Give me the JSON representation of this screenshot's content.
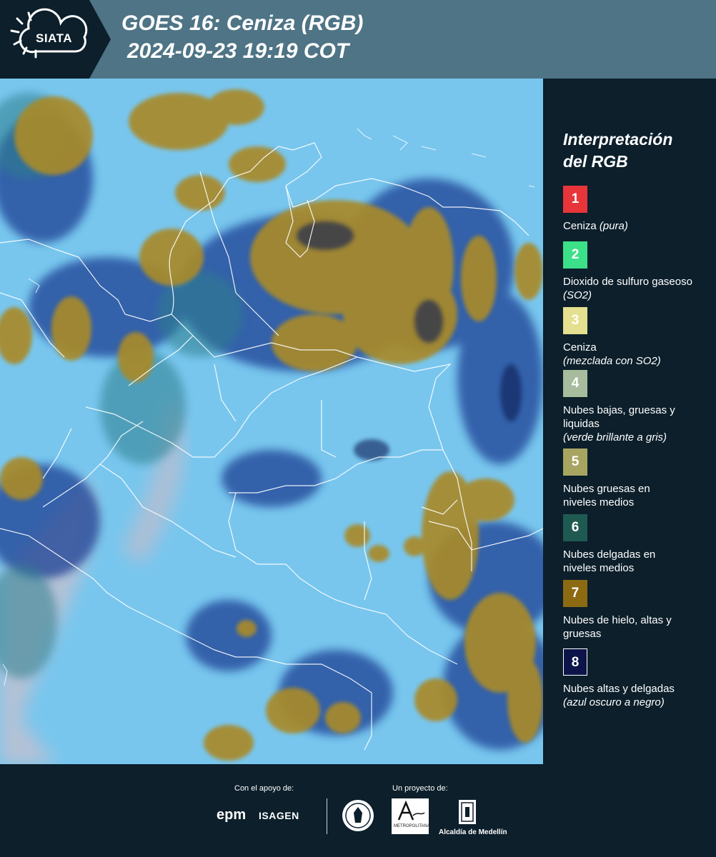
{
  "header": {
    "logo_text": "SIATA",
    "title_line1": "GOES 16: Ceniza (RGB)",
    "title_line2": "2024-09-23 19:19 COT"
  },
  "legend": {
    "title_line1": "Interpretación",
    "title_line2": "del RGB",
    "items": [
      {
        "number": "1",
        "color": "#e8353a",
        "label": "Ceniza",
        "note": "(pura)"
      },
      {
        "number": "2",
        "color": "#3ce089",
        "label": "Dioxido de sulfuro gaseoso",
        "note": "(SO2)"
      },
      {
        "number": "3",
        "color": "#e4e08f",
        "label": "Ceniza",
        "note": "(mezclada con SO2)"
      },
      {
        "number": "4",
        "color": "#a6bc9c",
        "label": "Nubes bajas, gruesas y liquidas",
        "note": "(verde brillante a gris)"
      },
      {
        "number": "5",
        "color": "#a8a560",
        "label": "Nubes gruesas en niveles medios",
        "note": ""
      },
      {
        "number": "6",
        "color": "#1f5a52",
        "label": "Nubes delgadas en niveles medios",
        "note": ""
      },
      {
        "number": "7",
        "color": "#8c6a12",
        "label": "Nubes de hielo, altas y gruesas",
        "note": ""
      },
      {
        "number": "8",
        "color": "#0c1449",
        "label": "Nubes altas y delgadas",
        "note": "(azul oscuro a negro)"
      }
    ]
  },
  "footer": {
    "support_label": "Con el apoyo de:",
    "project_label": "Un proyecto de:",
    "sponsor1": "epm",
    "sponsor2": "ISAGEN",
    "partner1": "METROPOLITANA",
    "partner2": "Alcaldía de Medellín"
  },
  "colors": {
    "header_bg": "#4e7485",
    "logo_bg": "#0c1f2b",
    "page_bg": "#0c1f2b",
    "sky": "#6fbde6",
    "ice_cloud": "#a88a2c",
    "thin_high_cloud": "#1a3a8a"
  }
}
